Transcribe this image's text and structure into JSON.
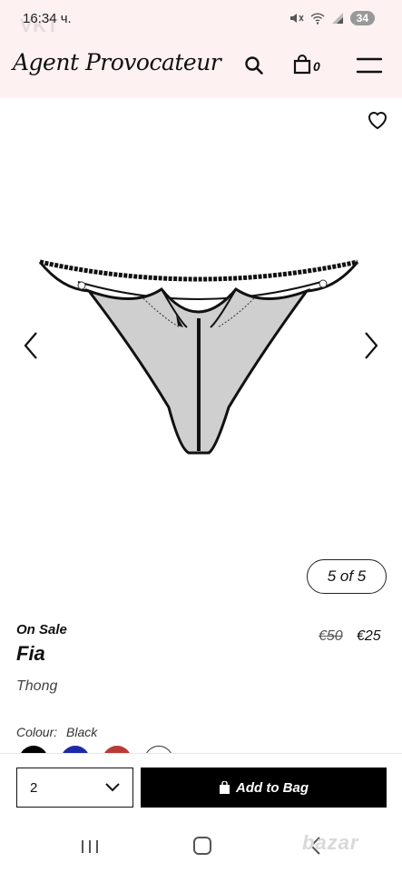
{
  "status_bar": {
    "time": "16:34 ч.",
    "watermark": "VKT",
    "battery": "34"
  },
  "header": {
    "logo": "Agent Provocateur",
    "bag_count": "0"
  },
  "gallery": {
    "counter": "5 of 5"
  },
  "product": {
    "sale_label": "On Sale",
    "name": "Fia",
    "type": "Thong",
    "price_old": "€50",
    "price_new": "€25",
    "colour_label": "Colour:",
    "colour_value": "Black",
    "swatches": [
      {
        "name": "black",
        "color": "#000000"
      },
      {
        "name": "blue",
        "color": "#1d2aa8"
      },
      {
        "name": "red",
        "color": "#b83a36"
      },
      {
        "name": "white",
        "color": "#ffffff"
      }
    ]
  },
  "purchase": {
    "quantity": "2",
    "add_label": "Add to Bag"
  },
  "nav": {
    "watermark": "bazar"
  },
  "colors": {
    "header_bg": "#fdf1f1",
    "button_bg": "#000000"
  }
}
